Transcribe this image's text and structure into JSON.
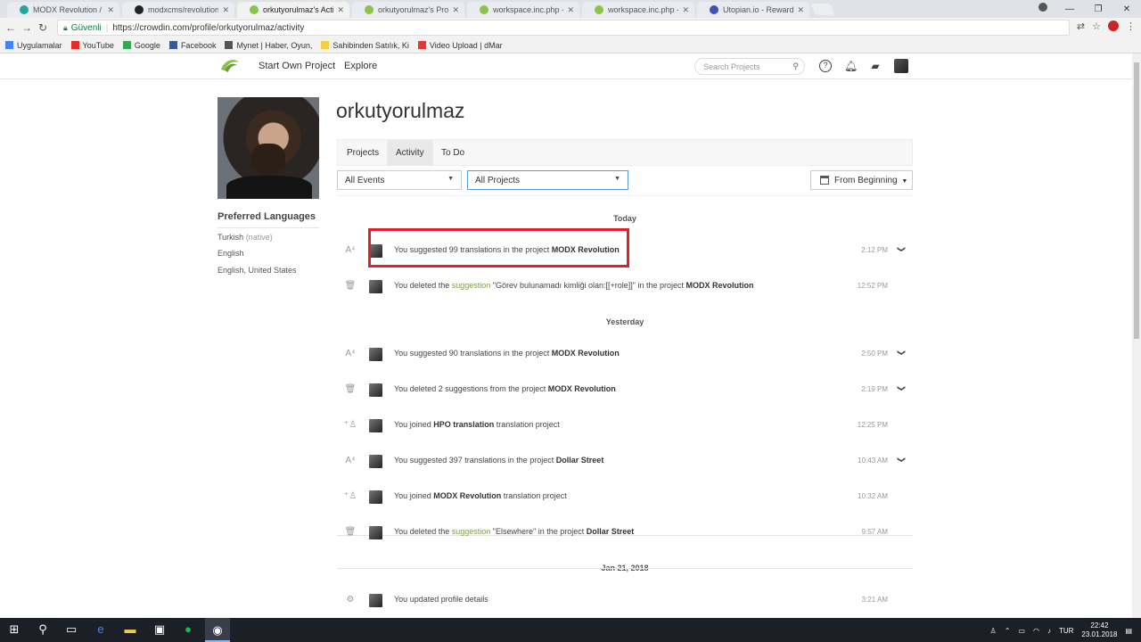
{
  "browser": {
    "tabs": [
      {
        "title": "MODX Revolution / Engl",
        "color": "#26a69a",
        "active": false
      },
      {
        "title": "modxcms/revolution: M",
        "color": "#222222",
        "active": false
      },
      {
        "title": "orkutyorulmaz's Activity",
        "color": "#8bc34a",
        "active": true
      },
      {
        "title": "orkutyorulmaz's Profile",
        "color": "#8bc34a",
        "active": false
      },
      {
        "title": "workspace.inc.php - MO",
        "color": "#8bc34a",
        "active": false
      },
      {
        "title": "workspace.inc.php - MO",
        "color": "#8bc34a",
        "active": false
      },
      {
        "title": "Utopian.io - Rewarding (",
        "color": "#3f51b5",
        "active": false
      }
    ],
    "close_glyph": "✕",
    "window_buttons": [
      "—",
      "❐",
      "✕"
    ],
    "address": {
      "secure_label": "Güvenli",
      "url": "https://crowdin.com/profile/orkutyorulmaz/activity"
    },
    "bookmarks": [
      {
        "label": "Uygulamalar",
        "color": "#4285f4"
      },
      {
        "label": "YouTube",
        "color": "#e52d27"
      },
      {
        "label": "Google",
        "color": "#34a853"
      },
      {
        "label": "Facebook",
        "color": "#3b5998"
      },
      {
        "label": "Mynet | Haber, Oyun,",
        "color": "#555555"
      },
      {
        "label": "Sahibinden Satılık, Ki",
        "color": "#f4d03f"
      },
      {
        "label": "Video Upload | dMar",
        "color": "#e53935"
      }
    ]
  },
  "header": {
    "nav": [
      "Start Own Project",
      "Explore"
    ],
    "search_placeholder": "Search Projects",
    "icons": [
      "help-icon",
      "bell-icon",
      "messages-icon"
    ],
    "brand_color": "#8bc34a"
  },
  "profile": {
    "username": "orkutyorulmaz",
    "preferred_languages_title": "Preferred Languages",
    "languages": [
      {
        "name": "Turkish",
        "note": "(native)"
      },
      {
        "name": "English",
        "note": ""
      },
      {
        "name": "English, United States",
        "note": ""
      }
    ],
    "tabs": [
      {
        "label": "Projects",
        "active": false
      },
      {
        "label": "Activity",
        "active": true
      },
      {
        "label": "To Do",
        "active": false
      }
    ],
    "filters": {
      "events": "All Events",
      "projects": "All Projects",
      "date": "From Beginning"
    }
  },
  "activity": {
    "today": "Today",
    "yesterday": "Yesterday",
    "jan21": "Jan 21, 2018",
    "rows": [
      {
        "icon": "translate-icon",
        "pre": "You suggested 99 translations in the project ",
        "bold": "MODX Revolution",
        "post": "",
        "time": "2:12 PM",
        "expand": true
      },
      {
        "icon": "trash-icon",
        "pre": "You deleted the ",
        "link": "suggestion",
        "mid": " \"Görev bulunamadı kimliği olan:[[+role]]\" in the project ",
        "bold": "MODX Revolution",
        "time": "12:52 PM",
        "expand": false
      },
      {
        "icon": "translate-icon",
        "pre": "You suggested 90 translations in the project ",
        "bold": "MODX Revolution",
        "post": "",
        "time": "2:50 PM",
        "expand": true
      },
      {
        "icon": "trash-icon",
        "pre": "You deleted 2 suggestions from the project ",
        "bold": "MODX Revolution",
        "post": "",
        "time": "2:19 PM",
        "expand": true
      },
      {
        "icon": "user-add-icon",
        "pre": "You joined ",
        "bold": "HPO translation",
        "post": " translation project",
        "time": "12:25 PM",
        "expand": false
      },
      {
        "icon": "translate-icon",
        "pre": "You suggested 397 translations in the project ",
        "bold": "Dollar Street",
        "post": "",
        "time": "10:43 AM",
        "expand": true
      },
      {
        "icon": "user-add-icon",
        "pre": "You joined ",
        "bold": "MODX Revolution",
        "post": " translation project",
        "time": "10:32 AM",
        "expand": false
      },
      {
        "icon": "trash-icon",
        "pre": "You deleted the ",
        "link": "suggestion",
        "mid": " \"Elsewhere\" in the project ",
        "bold": "Dollar Street",
        "time": "9:57 AM",
        "expand": false
      },
      {
        "icon": "gear-icon",
        "pre": "You updated profile details",
        "bold": "",
        "post": "",
        "time": "3:21 AM",
        "expand": false
      }
    ]
  },
  "taskbar": {
    "language": "TUR",
    "time": "22:42",
    "date": "23.01.2018"
  }
}
